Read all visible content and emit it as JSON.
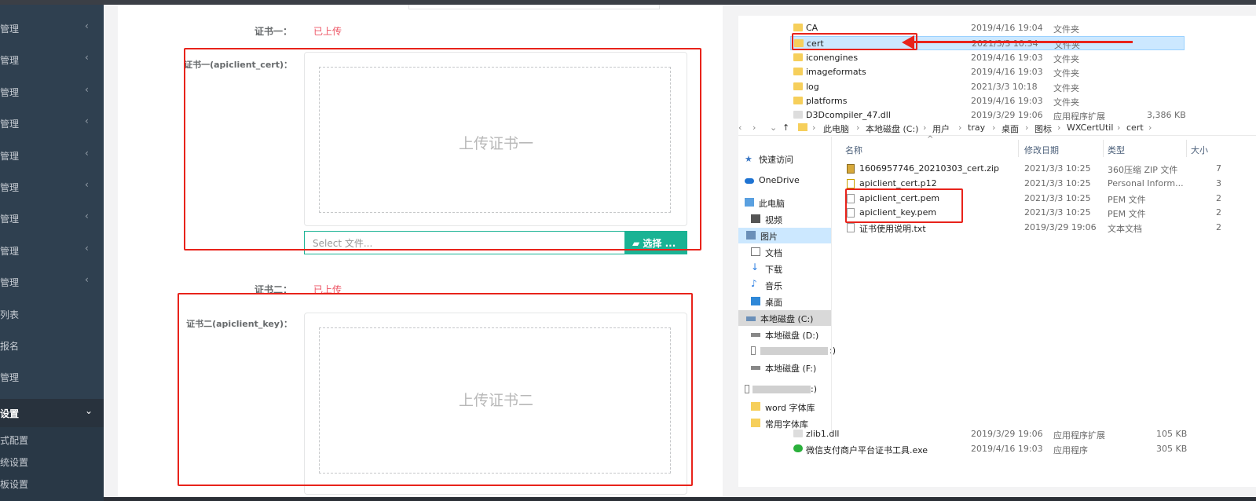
{
  "sidebar": {
    "items": [
      {
        "label": "管理",
        "chevron": "‹"
      },
      {
        "label": "管理",
        "chevron": "‹"
      },
      {
        "label": "管理",
        "chevron": "‹"
      },
      {
        "label": "管理",
        "chevron": "‹"
      },
      {
        "label": "管理",
        "chevron": "‹"
      },
      {
        "label": "管理",
        "chevron": "‹"
      },
      {
        "label": "管理",
        "chevron": "‹"
      },
      {
        "label": "管理",
        "chevron": "‹"
      },
      {
        "label": "管理",
        "chevron": "‹"
      },
      {
        "label": "列表",
        "chevron": ""
      },
      {
        "label": "报名",
        "chevron": ""
      },
      {
        "label": "管理",
        "chevron": ""
      }
    ],
    "active": {
      "label": "设置",
      "chevron": "⌄"
    },
    "subs": [
      "式配置",
      "统设置",
      "板设置"
    ]
  },
  "form": {
    "cert1": {
      "label": "证书一：",
      "status": "已上传",
      "field_label": "证书一(apiclient_cert)：",
      "drop_text": "上传证书一",
      "file_placeholder": "Select 文件...",
      "choose": "选择 ..."
    },
    "cert2": {
      "label": "证书二：",
      "status": "已上传",
      "field_label": "证书二(apiclient_key)：",
      "drop_text": "上传证书二"
    }
  },
  "explorer": {
    "folders": [
      {
        "name": "CA",
        "date": "2019/4/16 19:04",
        "type": "文件夹",
        "size": ""
      },
      {
        "name": "cert",
        "date": "2021/3/3 10:34",
        "type": "文件夹",
        "size": ""
      },
      {
        "name": "iconengines",
        "date": "2019/4/16 19:03",
        "type": "文件夹",
        "size": ""
      },
      {
        "name": "imageformats",
        "date": "2019/4/16 19:03",
        "type": "文件夹",
        "size": ""
      },
      {
        "name": "log",
        "date": "2021/3/3 10:18",
        "type": "文件夹",
        "size": ""
      },
      {
        "name": "platforms",
        "date": "2019/4/16 19:03",
        "type": "文件夹",
        "size": ""
      },
      {
        "name": "D3Dcompiler_47.dll",
        "date": "2019/3/29 19:06",
        "type": "应用程序扩展",
        "size": "3,386 KB"
      }
    ],
    "breadcrumb": [
      "此电脑",
      "本地磁盘 (C:)",
      "用户",
      "tray",
      "桌面",
      "图标",
      "WXCertUtil",
      "cert"
    ],
    "nav": [
      {
        "label": "快速访问",
        "icon": "star-icon"
      },
      {
        "label": "OneDrive",
        "icon": "cloud-icon"
      },
      {
        "label": "此电脑",
        "icon": "computer-icon"
      },
      {
        "label": "视频",
        "icon": "video-icon"
      },
      {
        "label": "图片",
        "icon": "picture-icon"
      },
      {
        "label": "文档",
        "icon": "document-icon"
      },
      {
        "label": "下载",
        "icon": "download-icon"
      },
      {
        "label": "音乐",
        "icon": "music-icon"
      },
      {
        "label": "桌面",
        "icon": "desktop-icon"
      },
      {
        "label": "本地磁盘 (C:)",
        "icon": "drive-icon"
      },
      {
        "label": "本地磁盘 (D:)",
        "icon": "drive-icon"
      },
      {
        "label": ":)",
        "icon": "usb-icon"
      },
      {
        "label": "本地磁盘 (F:)",
        "icon": "drive-icon"
      },
      {
        "label": ":)",
        "icon": "usb-icon"
      },
      {
        "label": "word  字体库",
        "icon": "folder-icon"
      },
      {
        "label": "常用字体库",
        "icon": "folder-icon"
      }
    ],
    "headers": {
      "name": "名称",
      "date": "修改日期",
      "type": "类型",
      "size": "大小"
    },
    "files": [
      {
        "name": "1606957746_20210303_cert.zip",
        "date": "2021/3/3 10:25",
        "type": "360压缩 ZIP 文件",
        "size": "7"
      },
      {
        "name": "apiclient_cert.p12",
        "date": "2021/3/3 10:25",
        "type": "Personal Inform...",
        "size": "3"
      },
      {
        "name": "apiclient_cert.pem",
        "date": "2021/3/3 10:25",
        "type": "PEM 文件",
        "size": "2"
      },
      {
        "name": "apiclient_key.pem",
        "date": "2021/3/3 10:25",
        "type": "PEM 文件",
        "size": "2"
      },
      {
        "name": "证书使用说明.txt",
        "date": "2019/3/29 19:06",
        "type": "文本文档",
        "size": "2"
      }
    ],
    "bottom_files": [
      {
        "name": "zlib1.dll",
        "date": "2019/3/29 19:06",
        "type": "应用程序扩展",
        "size": "105 KB"
      },
      {
        "name": "微信支付商户平台证书工具.exe",
        "date": "2019/4/16 19:03",
        "type": "应用程序",
        "size": "305 KB"
      }
    ]
  },
  "colors": {
    "accent": "#1ab394",
    "danger": "#ed5565",
    "annotation": "#e8231b",
    "sidebar": "#2f4050"
  }
}
